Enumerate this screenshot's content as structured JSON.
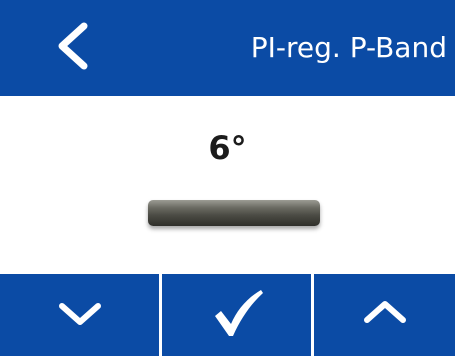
{
  "header": {
    "title": "PI-reg. P-Band",
    "back_icon": "chevron-left-icon"
  },
  "setting": {
    "value": "6°"
  },
  "footer": {
    "decrease_icon": "chevron-down-icon",
    "confirm_icon": "checkmark-icon",
    "increase_icon": "chevron-up-icon"
  },
  "colors": {
    "accent": "#0b4ba5",
    "background": "#ffffff",
    "value_bar": "#4a4a43"
  }
}
